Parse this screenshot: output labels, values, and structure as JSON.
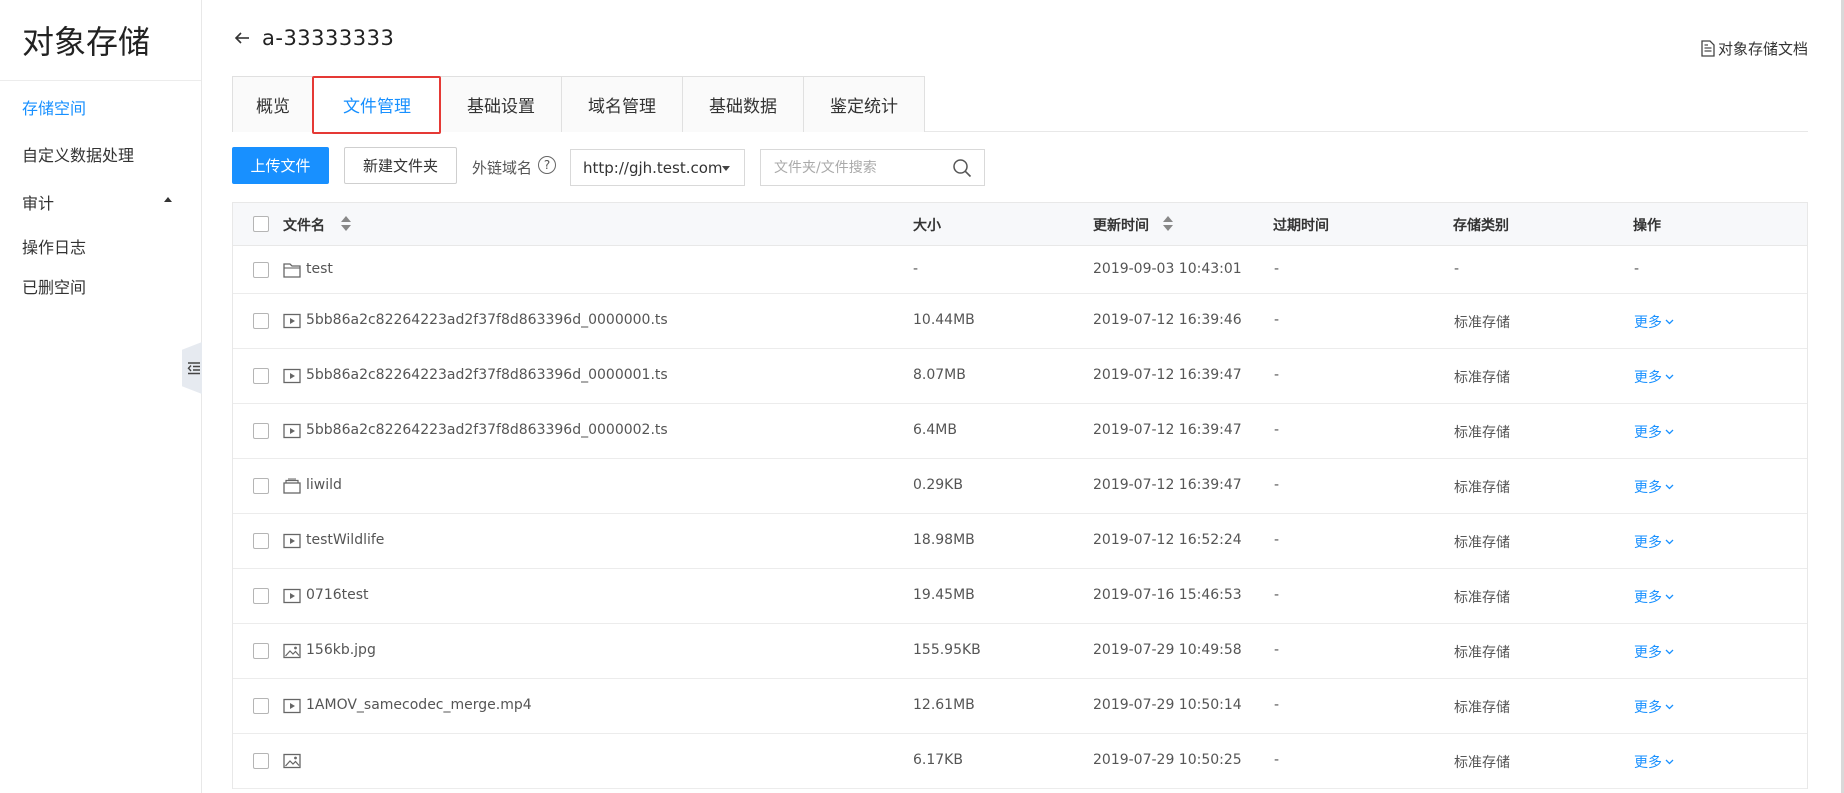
{
  "sidebar": {
    "title": "对象存储",
    "items": [
      {
        "label": "存储空间",
        "active": true
      },
      {
        "label": "自定义数据处理",
        "active": false
      },
      {
        "label": "审计",
        "active": false
      },
      {
        "label": "操作日志",
        "active": false
      },
      {
        "label": "已删空间",
        "active": false
      }
    ],
    "collapse_icon": "outdent-icon"
  },
  "header": {
    "back_icon": "arrow-left-icon",
    "title": "a-33333333",
    "doc_link": "对象存储文档",
    "doc_icon": "document-icon"
  },
  "tabs": [
    {
      "label": "概览",
      "active": false
    },
    {
      "label": "文件管理",
      "active": true
    },
    {
      "label": "基础设置",
      "active": false
    },
    {
      "label": "域名管理",
      "active": false
    },
    {
      "label": "基础数据",
      "active": false
    },
    {
      "label": "鉴定统计",
      "active": false
    }
  ],
  "toolbar": {
    "upload_label": "上传文件",
    "new_folder_label": "新建文件夹",
    "domain_label": "外链域名",
    "domain_value": "http://gjh.test.com",
    "search_placeholder": "文件夹/文件搜索"
  },
  "table": {
    "columns": [
      "文件名",
      "大小",
      "更新时间",
      "过期时间",
      "存储类别",
      "操作"
    ],
    "rows": [
      {
        "icon": "folder-icon",
        "name": "test",
        "size": "-",
        "updated": "2019-09-03 10:43:01",
        "expire": "-",
        "storage": "-",
        "action": "-"
      },
      {
        "icon": "video-icon",
        "name": "5bb86a2c82264223ad2f37f8d863396d_0000000.ts",
        "size": "10.44MB",
        "updated": "2019-07-12 16:39:46",
        "expire": "-",
        "storage": "标准存储",
        "action": "更多"
      },
      {
        "icon": "video-icon",
        "name": "5bb86a2c82264223ad2f37f8d863396d_0000001.ts",
        "size": "8.07MB",
        "updated": "2019-07-12 16:39:47",
        "expire": "-",
        "storage": "标准存储",
        "action": "更多"
      },
      {
        "icon": "video-icon",
        "name": "5bb86a2c82264223ad2f37f8d863396d_0000002.ts",
        "size": "6.4MB",
        "updated": "2019-07-12 16:39:47",
        "expire": "-",
        "storage": "标准存储",
        "action": "更多"
      },
      {
        "icon": "archive-icon",
        "name": "liwild",
        "size": "0.29KB",
        "updated": "2019-07-12 16:39:47",
        "expire": "-",
        "storage": "标准存储",
        "action": "更多"
      },
      {
        "icon": "video-icon",
        "name": "testWildlife",
        "size": "18.98MB",
        "updated": "2019-07-12 16:52:24",
        "expire": "-",
        "storage": "标准存储",
        "action": "更多"
      },
      {
        "icon": "video-icon",
        "name": "0716test",
        "size": "19.45MB",
        "updated": "2019-07-16 15:46:53",
        "expire": "-",
        "storage": "标准存储",
        "action": "更多"
      },
      {
        "icon": "image-icon",
        "name": "156kb.jpg",
        "size": "155.95KB",
        "updated": "2019-07-29 10:49:58",
        "expire": "-",
        "storage": "标准存储",
        "action": "更多"
      },
      {
        "icon": "video-icon",
        "name": "1AMOV_samecodec_merge.mp4",
        "size": "12.61MB",
        "updated": "2019-07-29 10:50:14",
        "expire": "-",
        "storage": "标准存储",
        "action": "更多"
      },
      {
        "icon": "image-icon",
        "name": "",
        "size": "6.17KB",
        "updated": "2019-07-29 10:50:25",
        "expire": "-",
        "storage": "标准存储",
        "action": "更多"
      }
    ]
  },
  "colors": {
    "accent": "#1890ff",
    "highlight_border": "#e53935"
  }
}
